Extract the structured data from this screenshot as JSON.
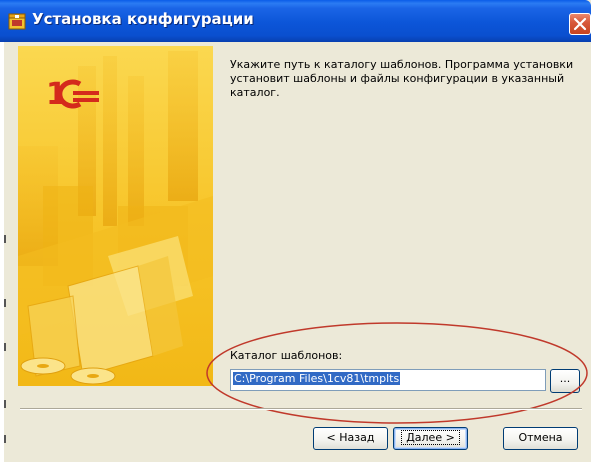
{
  "window": {
    "title": "Установка конфигурации",
    "title_icon": "setup-box-icon",
    "close_icon": "close-icon"
  },
  "banner": {
    "logo": "1С",
    "description": "decorative yellow banner with 1C logo"
  },
  "info": {
    "text": "Укажите путь к каталогу шаблонов. Программа установки установит шаблоны и файлы конфигурации в указанный каталог."
  },
  "directory": {
    "label": "Каталог шаблонов:",
    "value": "C:\\Program Files\\1cv81\\tmplts",
    "browse_label": "..."
  },
  "buttons": {
    "back": "< Назад",
    "next": "Далее >",
    "cancel": "Отмена"
  },
  "colors": {
    "titlebar": "#0a55d8",
    "banner": "#f5c518",
    "ellipse": "#c0392b",
    "selection": "#316ac5"
  }
}
